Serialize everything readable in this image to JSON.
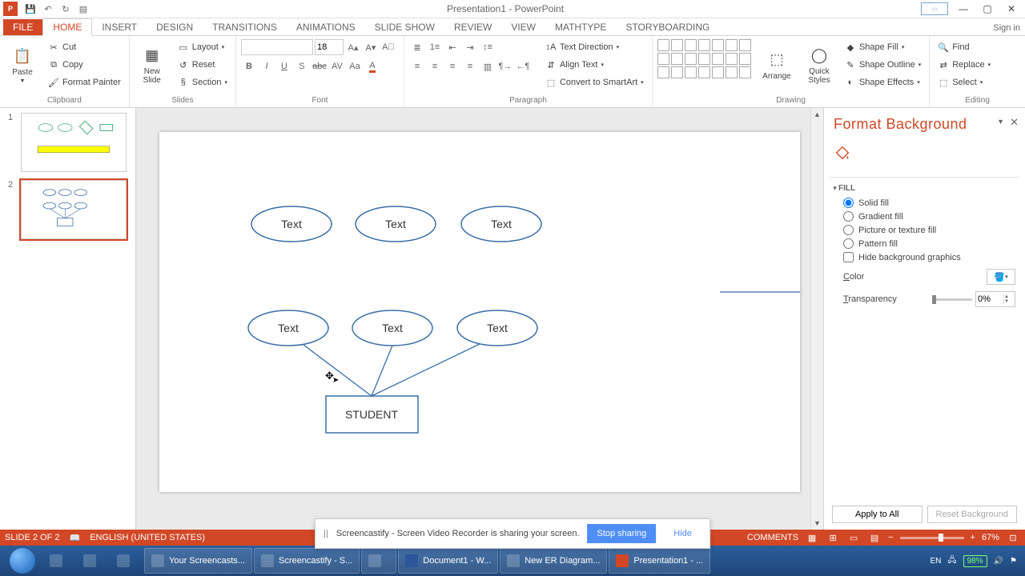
{
  "titlebar": {
    "title": "Presentation1 - PowerPoint",
    "signin": "Sign in"
  },
  "tabs": [
    "FILE",
    "HOME",
    "INSERT",
    "DESIGN",
    "TRANSITIONS",
    "ANIMATIONS",
    "SLIDE SHOW",
    "REVIEW",
    "VIEW",
    "MathType",
    "STORYBOARDING"
  ],
  "ribbon": {
    "clipboard": {
      "label": "Clipboard",
      "paste": "Paste",
      "cut": "Cut",
      "copy": "Copy",
      "fmt": "Format Painter"
    },
    "slides": {
      "label": "Slides",
      "new": "New\nSlide",
      "layout": "Layout",
      "reset": "Reset",
      "section": "Section"
    },
    "font": {
      "label": "Font",
      "size": "18"
    },
    "paragraph": {
      "label": "Paragraph",
      "dir": "Text Direction",
      "align": "Align Text",
      "smart": "Convert to SmartArt"
    },
    "drawing": {
      "label": "Drawing",
      "arrange": "Arrange",
      "styles": "Quick\nStyles",
      "fill": "Shape Fill",
      "outline": "Shape Outline",
      "effects": "Shape Effects"
    },
    "editing": {
      "label": "Editing",
      "find": "Find",
      "replace": "Replace",
      "select": "Select"
    }
  },
  "pane": {
    "title": "Format Background",
    "section": "FILL",
    "solid": "Solid fill",
    "gradient": "Gradient fill",
    "picture": "Picture or texture fill",
    "pattern": "Pattern fill",
    "hide": "Hide background graphics",
    "color": "Color",
    "transparency": "Transparency",
    "trans_val": "0%",
    "apply": "Apply to All",
    "reset": "Reset Background"
  },
  "slide": {
    "ovals": [
      "Text",
      "Text",
      "Text",
      "Text",
      "Text",
      "Text"
    ],
    "box": "STUDENT"
  },
  "status": {
    "slide": "SLIDE 2 OF 2",
    "lang": "ENGLISH (UNITED STATES)",
    "comments": "COMMENTS",
    "zoom": "67%"
  },
  "share": {
    "msg": "Screencastify - Screen Video Recorder is sharing your screen.",
    "stop": "Stop sharing",
    "hide": "Hide"
  },
  "taskbar": {
    "apps": [
      "Your Screencasts...",
      "Screencastify - S...",
      "",
      "Document1 - W...",
      "New ER Diagram...",
      "Presentation1 - ..."
    ],
    "lang": "EN",
    "battery": "98%"
  }
}
